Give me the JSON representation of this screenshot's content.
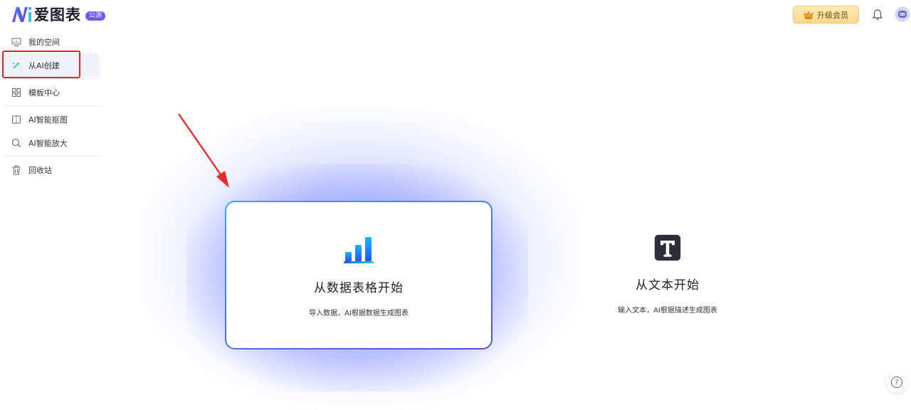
{
  "logo": {
    "text": "爱图表",
    "badge": "公测"
  },
  "header": {
    "upgrade_label": "升级会员",
    "upgrade_icon": "crown-icon",
    "bell_icon": "bell-icon",
    "avatar_icon": "robot-avatar-icon"
  },
  "sidebar": {
    "items": [
      {
        "label": "我的空间",
        "icon": "monitor-icon"
      },
      {
        "label": "从AI创建",
        "icon": "magic-wand-icon",
        "active": true
      },
      {
        "label": "模板中心",
        "icon": "grid-icon"
      },
      {
        "label": "AI智能抠图",
        "icon": "cutout-icon"
      },
      {
        "label": "AI智能放大",
        "icon": "zoom-icon"
      },
      {
        "label": "回收站",
        "icon": "trash-icon"
      }
    ]
  },
  "main": {
    "cards": [
      {
        "title": "从数据表格开始",
        "desc": "导入数据，AI根据数据生成图表",
        "icon": "bar-chart-icon"
      },
      {
        "title": "从文本开始",
        "desc": "输入文本，AI根据描述生成图表",
        "icon": "text-t-icon"
      }
    ]
  },
  "help_label": "?",
  "colors": {
    "accent": "#6b5bf0",
    "highlight_box": "#e1272b",
    "card_border_start": "#2fa8ff",
    "card_border_end": "#5d4bdc",
    "upgrade_bg": "#ffd98c"
  }
}
